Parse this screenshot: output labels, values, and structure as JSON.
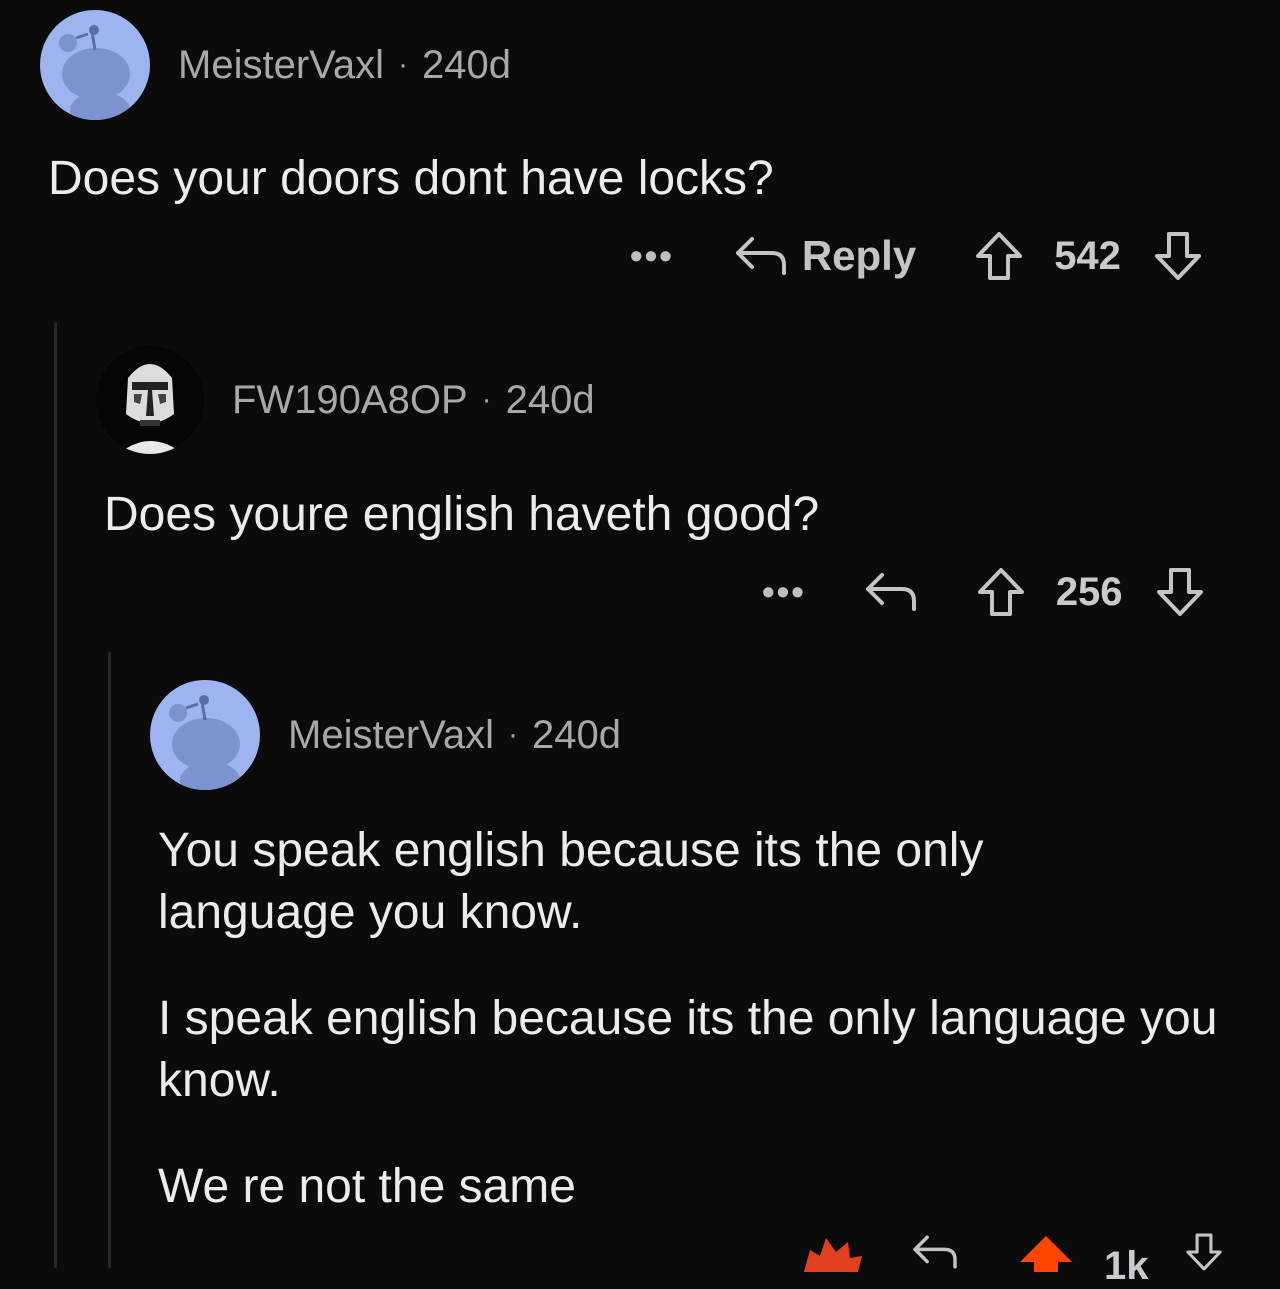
{
  "comments": [
    {
      "username": "MeisterVaxl",
      "separator": "·",
      "age": "240d",
      "body": [
        "Does your doors dont have locks?"
      ],
      "actions": {
        "more": "•••",
        "reply_label": "Reply",
        "score": "542"
      }
    },
    {
      "username": "FW190A8OP",
      "separator": "·",
      "age": "240d",
      "body": [
        "Does youre english haveth good?"
      ],
      "actions": {
        "more": "•••",
        "score": "256"
      }
    },
    {
      "username": "MeisterVaxl",
      "separator": "·",
      "age": "240d",
      "body": [
        "You speak english because its the only language you know.",
        "I speak english because its the only language you know.",
        "We re not the same"
      ],
      "actions": {
        "score": "1k"
      }
    }
  ],
  "colors": {
    "background": "#0b0b0c",
    "avatar_blue": "#9db4f0",
    "upvote_active": "#ff4500"
  },
  "icons": [
    "reddit-snoo-icon",
    "clone-trooper-icon",
    "reply-arrow-icon",
    "upvote-icon",
    "downvote-icon",
    "award-icon"
  ]
}
